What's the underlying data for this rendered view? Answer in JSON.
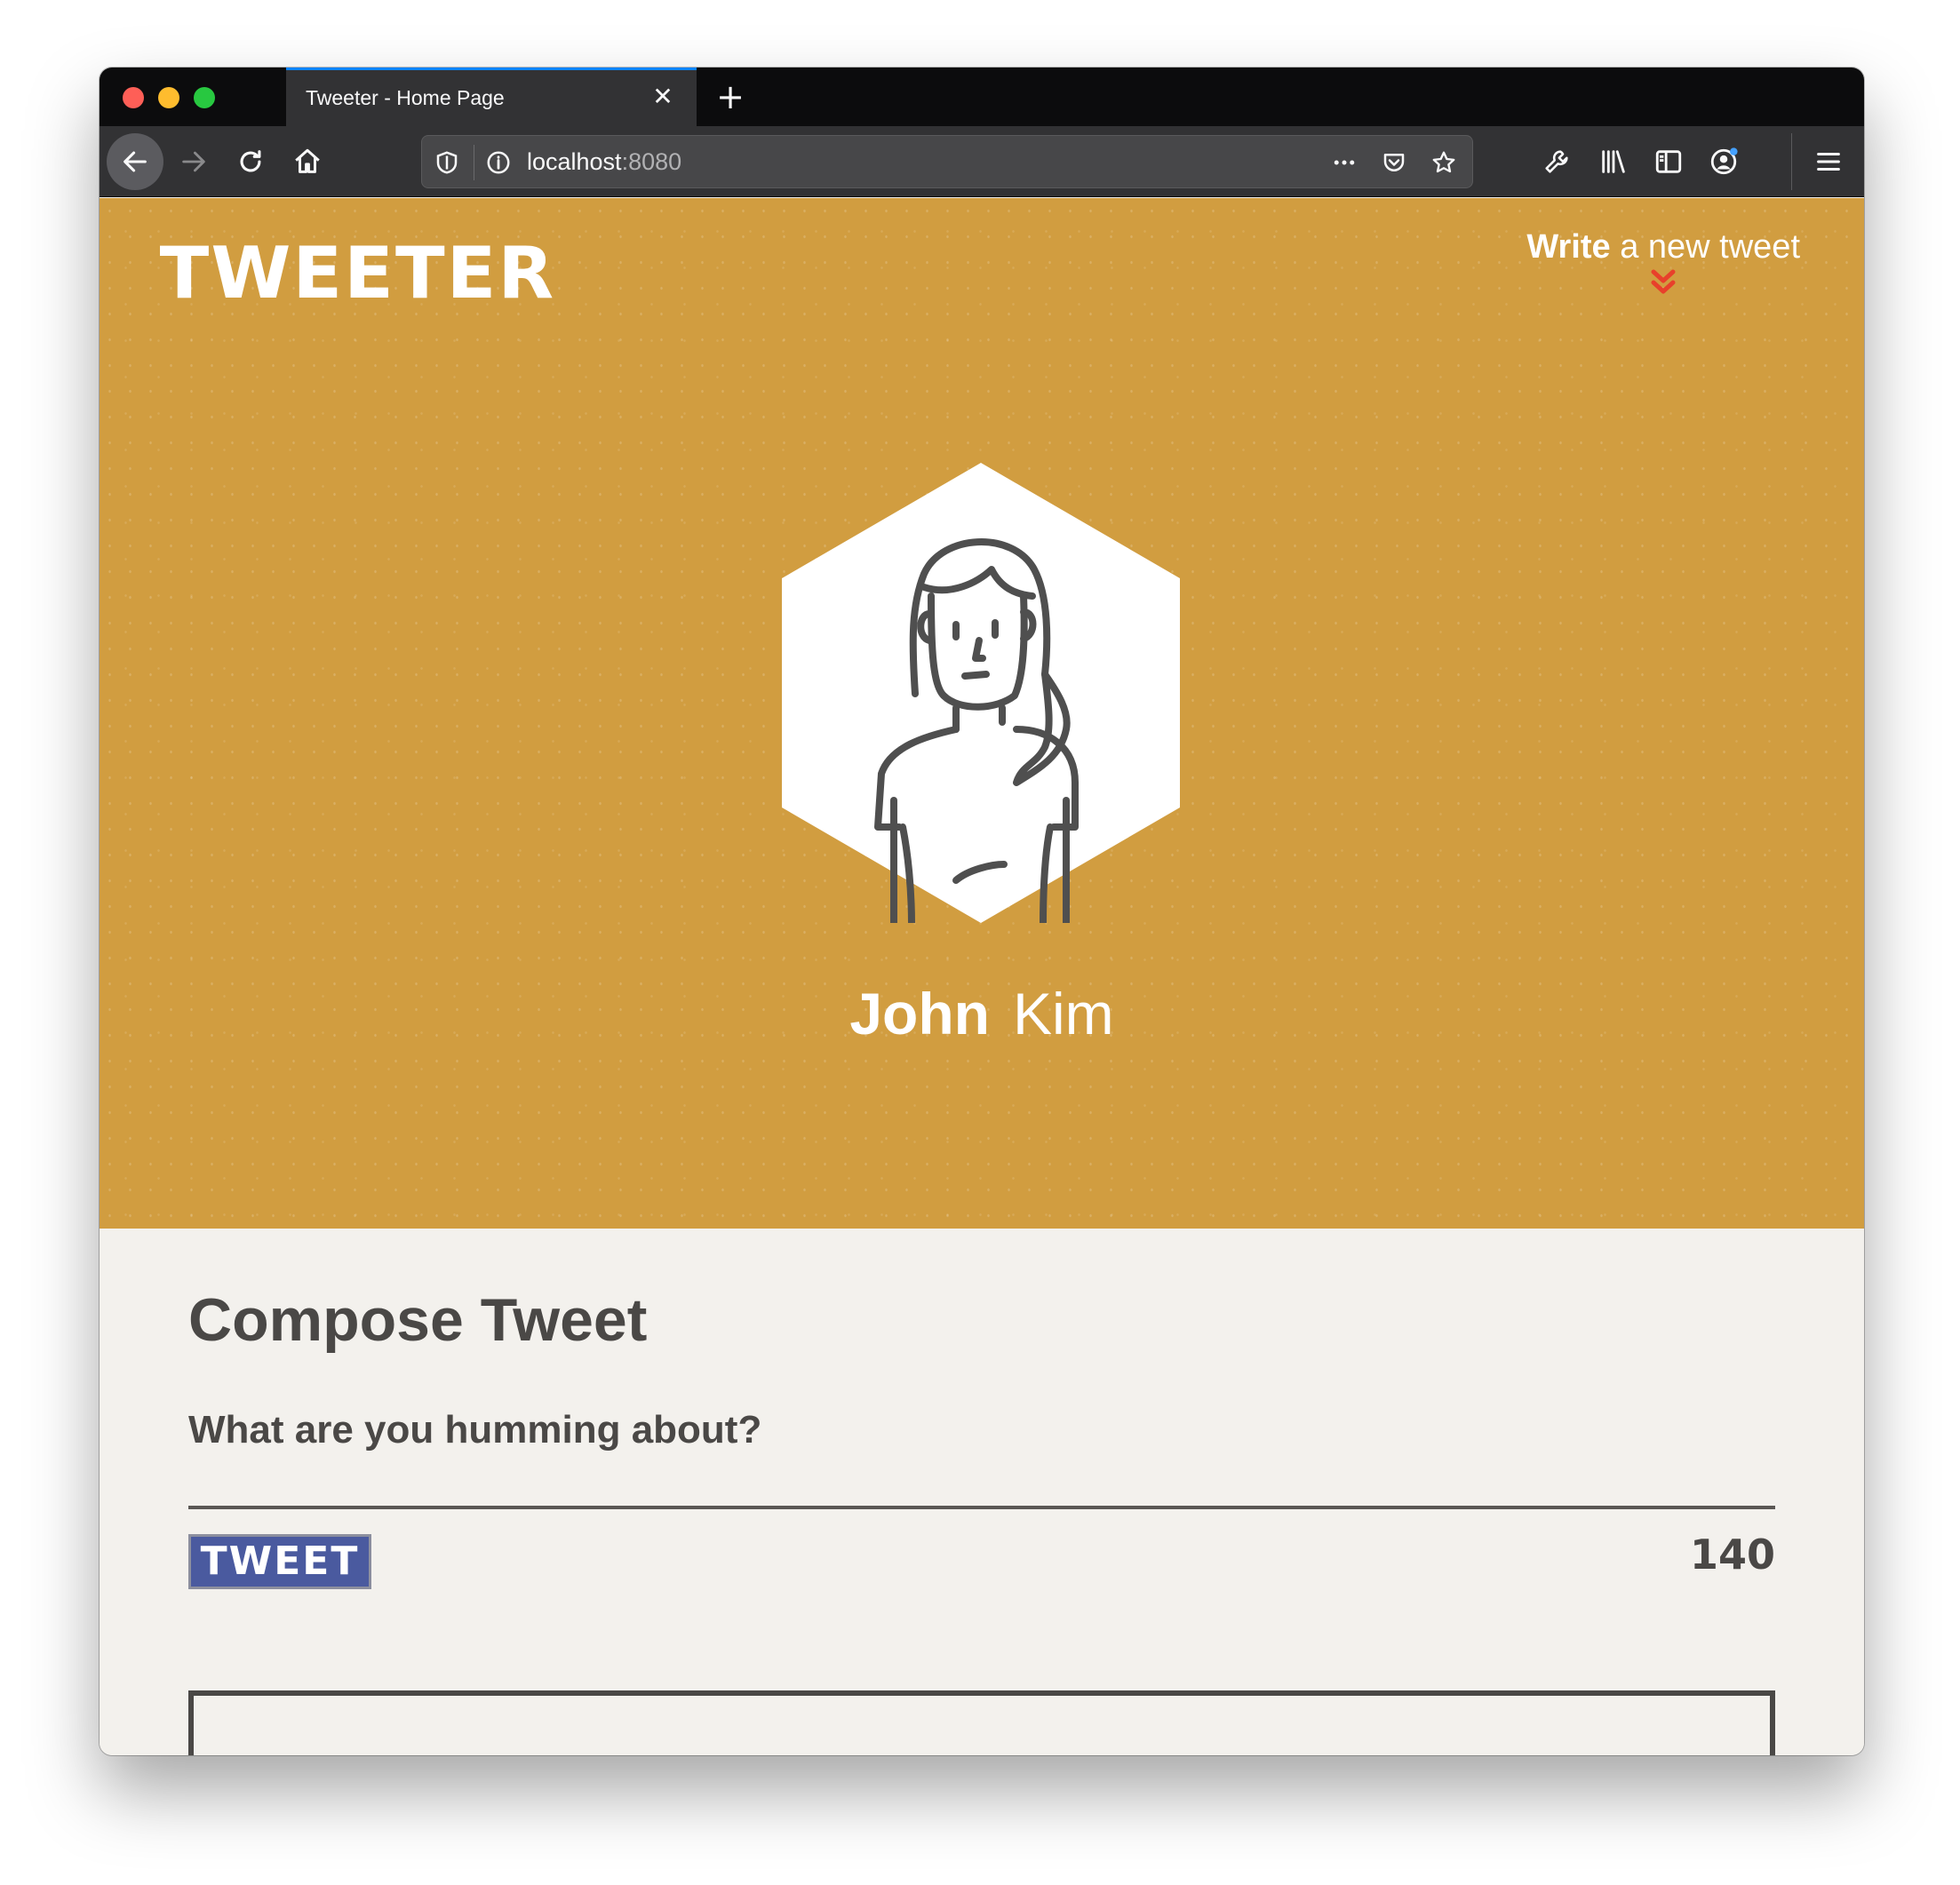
{
  "browser": {
    "tab_title": "Tweeter - Home Page",
    "tab_close_glyph": "✕",
    "new_tab_glyph": "+",
    "url_host": "localhost",
    "url_port": ":8080"
  },
  "header": {
    "logo": "TWEETER",
    "write_strong": "Write",
    "write_rest": " a new tweet"
  },
  "profile": {
    "first_name": "John",
    "last_name": "Kim",
    "avatar_icon": "woman-avatar-icon"
  },
  "compose": {
    "title": "Compose Tweet",
    "label": "What are you humming about?",
    "input_value": "",
    "button_label": "TWEET",
    "counter": "140"
  },
  "colors": {
    "hero": "#d19d40",
    "page_bg": "#f3f1ed",
    "text": "#4a4846",
    "button": "#4a5a9f",
    "chevron": "#e8402b"
  }
}
